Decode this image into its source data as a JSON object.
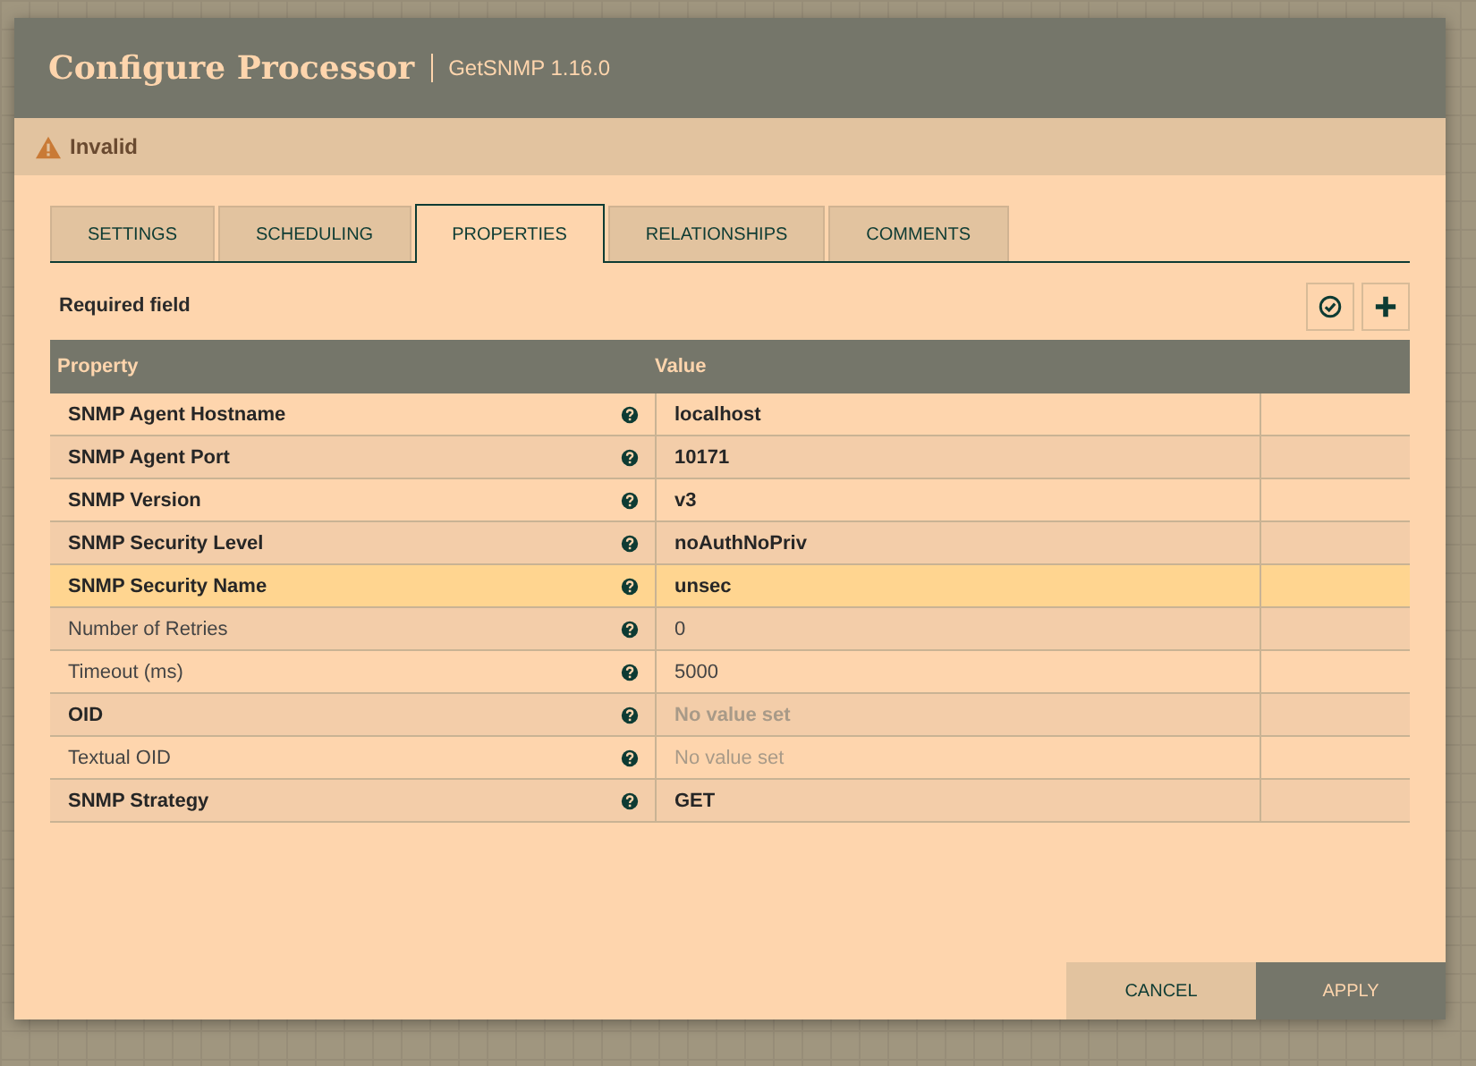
{
  "dialog": {
    "title": "Configure Processor",
    "subtitle": "GetSNMP 1.16.0"
  },
  "status": {
    "text": "Invalid"
  },
  "tabs": [
    {
      "label": "SETTINGS",
      "selected": false
    },
    {
      "label": "SCHEDULING",
      "selected": false
    },
    {
      "label": "PROPERTIES",
      "selected": true
    },
    {
      "label": "RELATIONSHIPS",
      "selected": false
    },
    {
      "label": "COMMENTS",
      "selected": false
    }
  ],
  "required_note": "Required field",
  "table": {
    "columns": [
      "Property",
      "Value"
    ],
    "rows": [
      {
        "property": "SNMP Agent Hostname",
        "value": "localhost",
        "required": true,
        "value_set": true,
        "selected": false
      },
      {
        "property": "SNMP Agent Port",
        "value": "10171",
        "required": true,
        "value_set": true,
        "selected": false
      },
      {
        "property": "SNMP Version",
        "value": "v3",
        "required": true,
        "value_set": true,
        "selected": false
      },
      {
        "property": "SNMP Security Level",
        "value": "noAuthNoPriv",
        "required": true,
        "value_set": true,
        "selected": false
      },
      {
        "property": "SNMP Security Name",
        "value": "unsec",
        "required": true,
        "value_set": true,
        "selected": true
      },
      {
        "property": "Number of Retries",
        "value": "0",
        "required": false,
        "value_set": true,
        "selected": false
      },
      {
        "property": "Timeout (ms)",
        "value": "5000",
        "required": false,
        "value_set": true,
        "selected": false
      },
      {
        "property": "OID",
        "value": "No value set",
        "required": true,
        "value_set": false,
        "selected": false
      },
      {
        "property": "Textual OID",
        "value": "No value set",
        "required": false,
        "value_set": false,
        "selected": false
      },
      {
        "property": "SNMP Strategy",
        "value": "GET",
        "required": true,
        "value_set": true,
        "selected": false
      }
    ]
  },
  "buttons": [
    {
      "label": "CANCEL",
      "kind": "secondary"
    },
    {
      "label": "APPLY",
      "kind": "primary"
    }
  ]
}
